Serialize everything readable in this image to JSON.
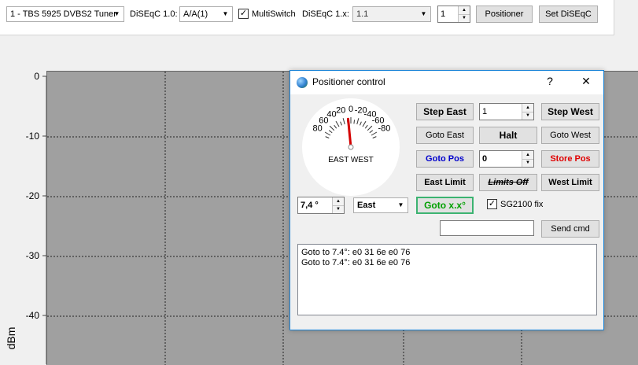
{
  "toolbar": {
    "tuner": "1 - TBS 5925 DVBS2 Tuner",
    "diseqc10_label": "DiSEqC 1.0:",
    "diseqc10_value": "A/A(1)",
    "multiswitch_label": "MultiSwitch",
    "multiswitch_checked": true,
    "diseqc1x_label": "DiSEqC 1.x:",
    "diseqc1x_value": "1.1",
    "diseqc1x_spin": "1",
    "positioner_btn": "Positioner",
    "set_diseqc_btn": "Set DiSEqC"
  },
  "plot": {
    "yticks": [
      "0",
      "-10",
      "-20",
      "-30",
      "-40"
    ],
    "ylabel": "dBm"
  },
  "dialog": {
    "title": "Positioner control",
    "help": "?",
    "close": "✕",
    "gauge": {
      "labels": [
        "80",
        "60",
        "40",
        "20",
        "0",
        "-20",
        "-40",
        "-60",
        "-80"
      ],
      "caption": "EAST WEST",
      "needle_value": 7.4
    },
    "step_east": "Step East",
    "step_value": "1",
    "step_west": "Step West",
    "goto_east": "Goto East",
    "halt": "Halt",
    "goto_west": "Goto West",
    "goto_pos": "Goto Pos",
    "pos_value": "0",
    "store_pos": "Store Pos",
    "east_limit": "East Limit",
    "limits_off": "Limits Off",
    "west_limit": "West Limit",
    "angle_value": "7,4 °",
    "direction": "East",
    "goto_xx": "Goto x.x°",
    "sg2100_label": "SG2100 fix",
    "sg2100_checked": true,
    "send_cmd": "Send cmd",
    "log": [
      "Goto to 7.4°: e0 31 6e e0 76",
      "Goto to 7.4°: e0 31 6e e0 76"
    ],
    "colors": {
      "goto_pos": "#0000cc",
      "store_pos": "#e00000",
      "goto_xx": "#00a000",
      "goto_xx_border": "#3cb371"
    }
  }
}
